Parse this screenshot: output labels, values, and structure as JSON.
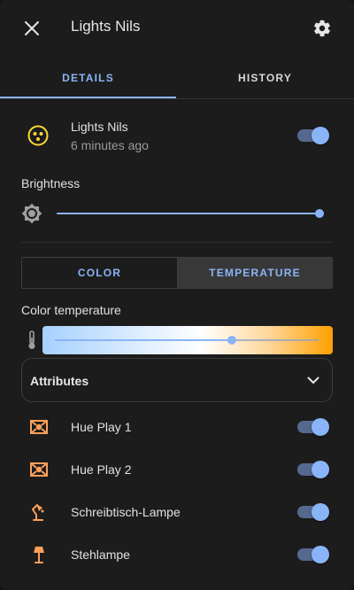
{
  "header": {
    "title": "Lights Nils"
  },
  "tabs": [
    {
      "label": "DETAILS",
      "active": true
    },
    {
      "label": "HISTORY",
      "active": false
    }
  ],
  "entity": {
    "name": "Lights Nils",
    "last_changed": "6 minutes ago",
    "icon": "lightbulb-group-icon",
    "state": "on"
  },
  "brightness": {
    "label": "Brightness",
    "value_percent": 100,
    "icon": "brightness-icon"
  },
  "mode": {
    "options": [
      "COLOR",
      "TEMPERATURE"
    ],
    "selected": "TEMPERATURE"
  },
  "color_temp": {
    "label": "Color temperature",
    "value_fraction": 0.67,
    "icon": "thermometer-icon"
  },
  "attributes": {
    "label": "Attributes",
    "expanded": false
  },
  "members": [
    {
      "name": "Hue Play 1",
      "icon": "hue-play-icon",
      "state": "on"
    },
    {
      "name": "Hue Play 2",
      "icon": "hue-play-icon",
      "state": "on"
    },
    {
      "name": "Schreibtisch-Lampe",
      "icon": "desk-lamp-icon",
      "state": "on"
    },
    {
      "name": "Stehlampe",
      "icon": "floor-lamp-icon",
      "state": "on"
    }
  ],
  "colors": {
    "accent": "#8ab4f8",
    "light_on_icon": "#fdd835",
    "member_icon": "#ffa05a",
    "background": "#1c1c1c"
  }
}
